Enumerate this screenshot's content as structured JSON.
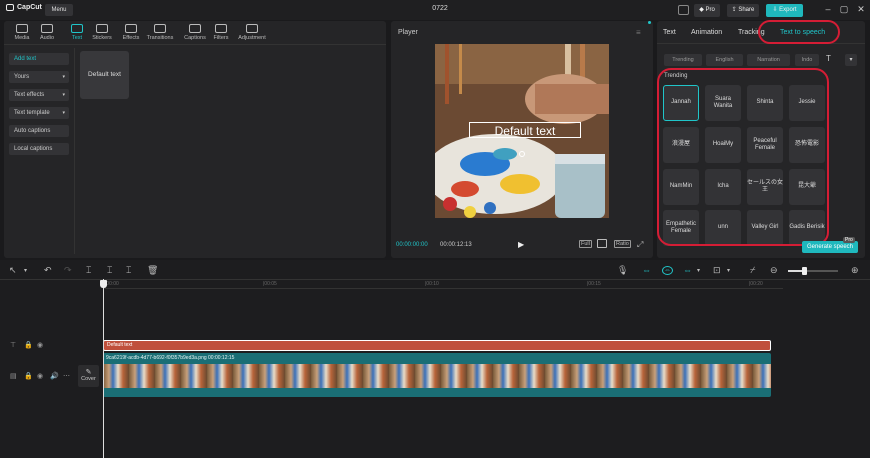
{
  "app": {
    "name": "CapCut",
    "menu_label": "Menu",
    "window_title": "0722"
  },
  "titlebar": {
    "pro_label": "Pro",
    "share_label": "Share",
    "export_label": "Export"
  },
  "toolbar": [
    {
      "label": "Media",
      "icon": "media-icon"
    },
    {
      "label": "Audio",
      "icon": "audio-icon"
    },
    {
      "label": "Text",
      "icon": "text-icon",
      "active": true
    },
    {
      "label": "Stickers",
      "icon": "stickers-icon"
    },
    {
      "label": "Effects",
      "icon": "effects-icon"
    },
    {
      "label": "Transitions",
      "icon": "transitions-icon"
    },
    {
      "label": "Captions",
      "icon": "captions-icon"
    },
    {
      "label": "Filters",
      "icon": "filters-icon"
    },
    {
      "label": "Adjustment",
      "icon": "adjustment-icon"
    }
  ],
  "sidebar": {
    "add_text": "Add text",
    "items": [
      "Yours",
      "Text effects",
      "Text template",
      "Auto captions",
      "Local captions"
    ]
  },
  "text_library": {
    "default_card": "Default text"
  },
  "player": {
    "title": "Player",
    "overlay_text": "Default text",
    "current_time": "00:00:00:00",
    "total_time": "00:00:12:13",
    "full_label": "Full",
    "ratio_label": "Ratio"
  },
  "right_panel": {
    "tabs": [
      "Text",
      "Animation",
      "Tracking",
      "Text to speech"
    ],
    "active_tab": "Text to speech",
    "filters": [
      "Trending",
      "English",
      "Narration",
      "Indo"
    ],
    "section_label": "Trending",
    "voices": [
      "Jannah",
      "Suara Wanita",
      "Shinta",
      "Jessie",
      "浪漫屋",
      "HoaiMy",
      "Peaceful Female",
      "恐怖電影",
      "NamMin",
      "Icha",
      "セールスの女王",
      "昆大爺",
      "Empathetic Female",
      "unn",
      "Valley Girl",
      "Gadis Berisik"
    ],
    "selected_voice": "Jannah",
    "generate_label": "Generate speech",
    "badge": "Pro"
  },
  "timeline": {
    "text_clip_label": "Default text",
    "video_clip_label": "9ca6219f-acdb-4d77-b692-f0f357b9ed3a.png  00:00:12:15",
    "cover_label": "Cover"
  },
  "colors": {
    "accent": "#20c5c9",
    "highlight": "#d51d35",
    "text_clip": "#c0503c",
    "video_clip": "#1a6e75"
  }
}
